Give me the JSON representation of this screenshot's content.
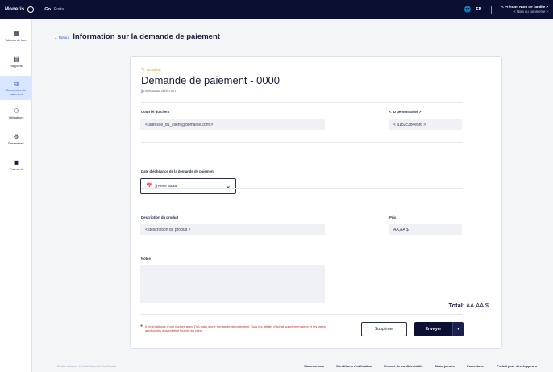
{
  "topbar": {
    "brand": "Moneris",
    "product_go": "Go",
    "product_portal": "Portal",
    "lang": "FR",
    "user_name": "< Prénom Nom de famille >",
    "user_shop": "< Nom du commerce >"
  },
  "sidebar": {
    "items": [
      {
        "label": "Tableau de bord",
        "icon": "dashboard-icon"
      },
      {
        "label": "Rapports",
        "icon": "reports-icon"
      },
      {
        "label": "Demandes de paiement",
        "icon": "payment-requests-icon",
        "active": true
      },
      {
        "label": "Utilisateurs",
        "icon": "users-icon"
      },
      {
        "label": "Paramètres",
        "icon": "settings-icon"
      },
      {
        "label": "Paiement",
        "icon": "payment-icon"
      }
    ]
  },
  "header": {
    "back": "← Retour",
    "title": "Information sur la demande de paiement"
  },
  "card": {
    "status": "Brouillon",
    "title": "Demande de paiement - 0000",
    "date": "jj mois aaaa à hh:mm",
    "client_email_label": "Courriel du client",
    "client_email_value": "< adresse_du_client@domaine.com >",
    "custom_id_label": "< ID personnalisé >",
    "custom_id_value": "< a1b2c3d4e5f6 >",
    "due_date_label": "Date d'échéance de la demande de paiement",
    "due_date_value": "jj mois aaaa",
    "product_desc_label": "Description du produit",
    "product_desc_value": "< description du produit >",
    "price_label": "Prix",
    "price_value": "AA,AA $",
    "notes_label": "Notes",
    "total_label": "Total:",
    "total_value": "AA,AA  $",
    "disclaimer": "Il ne s'agit pas d'une facture avec TVA mais d'une demande de paiement. Tous les détails d'achat supplémentaires et les taxes applicables doivent être fournis au client",
    "delete_label": "Supprimer",
    "send_label": "Envoyer",
    "send_dropdown": "▾"
  },
  "footer": {
    "copyright": "Droits d'auteur Portail Moneris Go ©aaaa",
    "links": [
      "Moneris.com",
      "Conditions d'utilisation",
      "Énoncé de confidentialité",
      "Nous joindre",
      "Fournitures",
      "Portail pour développeurs"
    ]
  }
}
